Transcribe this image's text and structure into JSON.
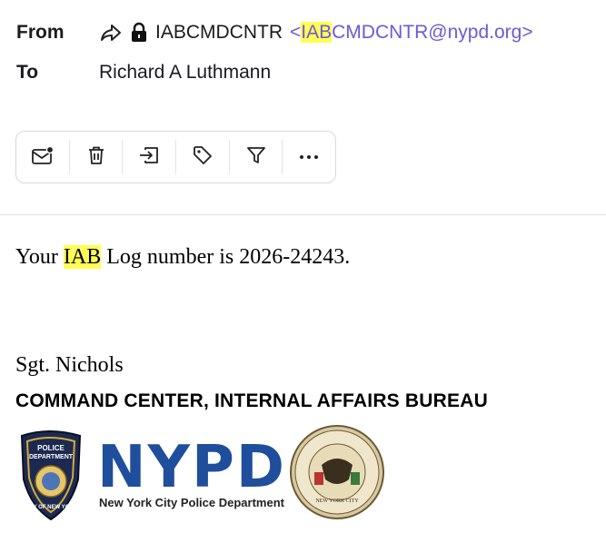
{
  "header": {
    "from_label": "From",
    "to_label": "To",
    "sender_name": "IABCMDCNTR",
    "sender_email_prefix": "<",
    "sender_email_highlight": "IAB",
    "sender_email_rest": "CMDCNTR@nypd.org>",
    "recipient": "Richard A Luthmann"
  },
  "toolbar": {
    "actions": [
      "mark-unread-icon",
      "delete-icon",
      "move-icon",
      "tag-icon",
      "filter-icon",
      "more-icon"
    ]
  },
  "message": {
    "line_prefix": "Your ",
    "line_highlight": "IAB",
    "line_rest": " Log number is 2026-24243."
  },
  "signature": {
    "name": "Sgt. Nichols",
    "department": "COMMAND CENTER, INTERNAL AFFAIRS BUREAU",
    "logo_text": "NYPD",
    "logo_subtext": "New York City Police Department"
  },
  "colors": {
    "email_link": "#6b5bd6",
    "highlight": "#ffff55",
    "nypd_blue": "#1f4e9c"
  }
}
